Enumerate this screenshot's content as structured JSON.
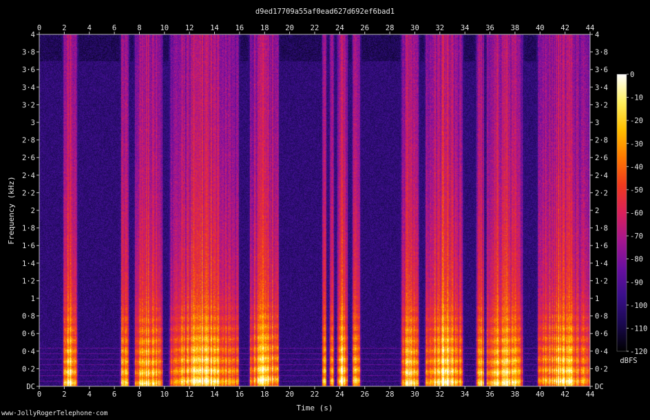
{
  "chart_data": {
    "type": "heatmap",
    "title": "d9ed17709a55af0ead627d692ef6bad1",
    "xlabel": "Time (s)",
    "ylabel": "Frequency (kHz)",
    "x_ticks": [
      "0",
      "2",
      "4",
      "6",
      "8",
      "10",
      "12",
      "14",
      "16",
      "18",
      "20",
      "22",
      "24",
      "26",
      "28",
      "30",
      "32",
      "34",
      "36",
      "38",
      "40",
      "42",
      "44"
    ],
    "y_ticks": [
      "DC",
      "0·2",
      "0·4",
      "0·6",
      "0·8",
      "1",
      "1·2",
      "1·4",
      "1·6",
      "1·8",
      "2",
      "2·2",
      "2·4",
      "2·6",
      "2·8",
      "3",
      "3·2",
      "3·4",
      "3·6",
      "3·8",
      "4"
    ],
    "xlim": [
      0,
      44
    ],
    "ylim_khz": [
      0,
      4
    ],
    "colorbar": {
      "label": "dBFS",
      "ticks": [
        "0",
        "-10",
        "-20",
        "-30",
        "-40",
        "-50",
        "-60",
        "-70",
        "-80",
        "-90",
        "-100",
        "-110",
        "-120"
      ],
      "range": [
        -120,
        0
      ],
      "colors": [
        "#000000",
        "#1a0850",
        "#3a0f8a",
        "#6a0fa0",
        "#a5168f",
        "#d9205a",
        "#f03a1e",
        "#ff7a00",
        "#ffbf00",
        "#fff060",
        "#ffffff"
      ]
    },
    "speech_segments_s": [
      [
        1.9,
        3.0
      ],
      [
        6.5,
        7.1
      ],
      [
        7.6,
        9.8
      ],
      [
        10.4,
        15.9
      ],
      [
        16.8,
        19.1
      ],
      [
        22.6,
        22.9
      ],
      [
        23.2,
        23.5
      ],
      [
        23.8,
        24.6
      ],
      [
        25.0,
        25.6
      ],
      [
        28.9,
        30.3
      ],
      [
        30.8,
        33.8
      ],
      [
        34.9,
        35.5
      ],
      [
        35.7,
        38.6
      ],
      [
        39.8,
        44.0
      ]
    ],
    "background_noise_dbfs": -100
  },
  "footer": "www·JollyRogerTelephone·com"
}
